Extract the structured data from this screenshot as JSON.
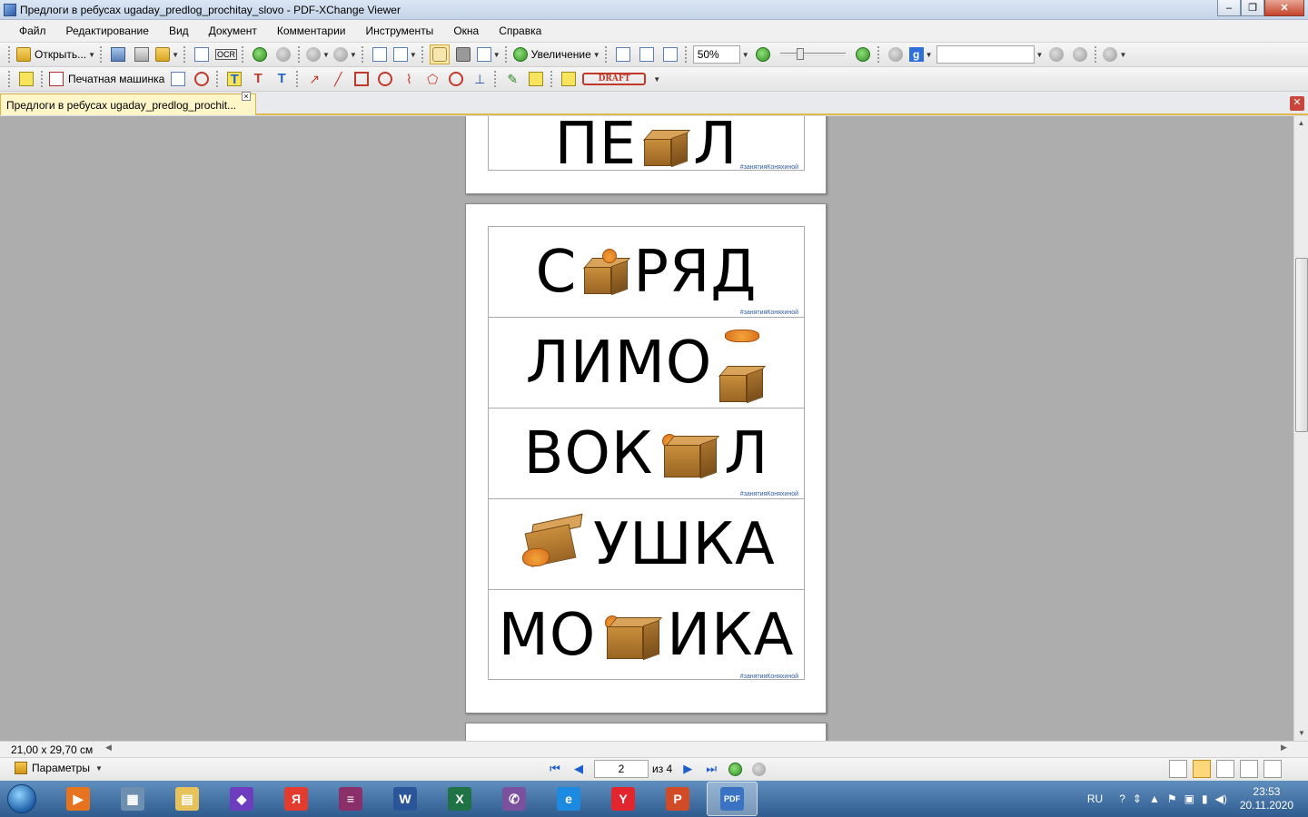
{
  "window": {
    "title": "Предлоги в ребусах ugaday_predlog_prochitay_slovo - PDF-XChange Viewer"
  },
  "menu": [
    "Файл",
    "Редактирование",
    "Вид",
    "Документ",
    "Комментарии",
    "Инструменты",
    "Окна",
    "Справка"
  ],
  "toolbar1": {
    "open_label": "Открыть...",
    "ocr_label": "OCR",
    "zoom_label": "Увеличение",
    "zoom_value": "50%"
  },
  "toolbar2": {
    "typewriter_label": "Печатная машинка",
    "draft_stamp": "DRAFT"
  },
  "tab": {
    "label": "Предлоги в ребусах ugaday_predlog_prochit..."
  },
  "pages": {
    "p1": {
      "rows": [
        {
          "left": "ПЕ",
          "right": "Л",
          "tag": "#занятияКоняхиной"
        }
      ]
    },
    "p2": {
      "rows": [
        {
          "left": "С",
          "right": "РЯД",
          "tag": "#занятияКоняхиной"
        },
        {
          "left": "ЛИМО",
          "right": "",
          "tag": ""
        },
        {
          "left": "ВОК",
          "right": "Л",
          "tag": "#занятияКоняхиной"
        },
        {
          "left": "",
          "right": "УШКА",
          "tag": ""
        },
        {
          "left": "МО",
          "right": "ИКА",
          "tag": "#занятияКоняхиной"
        }
      ]
    }
  },
  "status": {
    "page_size": "21,00 x 29,70 см",
    "params_label": "Параметры",
    "current_page": "2",
    "of_total": "из 4"
  },
  "taskbar": {
    "apps": [
      {
        "name": "media-player-icon",
        "color": "#e8731e",
        "glyph": "▶"
      },
      {
        "name": "calculator-icon",
        "color": "#6f8fb0",
        "glyph": "▦"
      },
      {
        "name": "explorer-icon",
        "color": "#e7c25a",
        "glyph": "▤"
      },
      {
        "name": "visual-studio-icon",
        "color": "#6d3cbf",
        "glyph": "◆"
      },
      {
        "name": "yandex-icon",
        "color": "#e33b2e",
        "glyph": "Я"
      },
      {
        "name": "winrar-icon",
        "color": "#8a2f6a",
        "glyph": "≡"
      },
      {
        "name": "word-icon",
        "color": "#2a5699",
        "glyph": "W"
      },
      {
        "name": "excel-icon",
        "color": "#1f7244",
        "glyph": "X"
      },
      {
        "name": "viber-icon",
        "color": "#7b519d",
        "glyph": "✆"
      },
      {
        "name": "internet-explorer-icon",
        "color": "#1c8ae0",
        "glyph": "e"
      },
      {
        "name": "yandex-browser-icon",
        "color": "#e3252e",
        "glyph": "Y"
      },
      {
        "name": "powerpoint-icon",
        "color": "#d04b26",
        "glyph": "P"
      },
      {
        "name": "pdf-xchange-icon",
        "color": "#3b73c4",
        "glyph": "PDF"
      }
    ],
    "language": "RU",
    "time": "23:53",
    "date": "20.11.2020"
  }
}
